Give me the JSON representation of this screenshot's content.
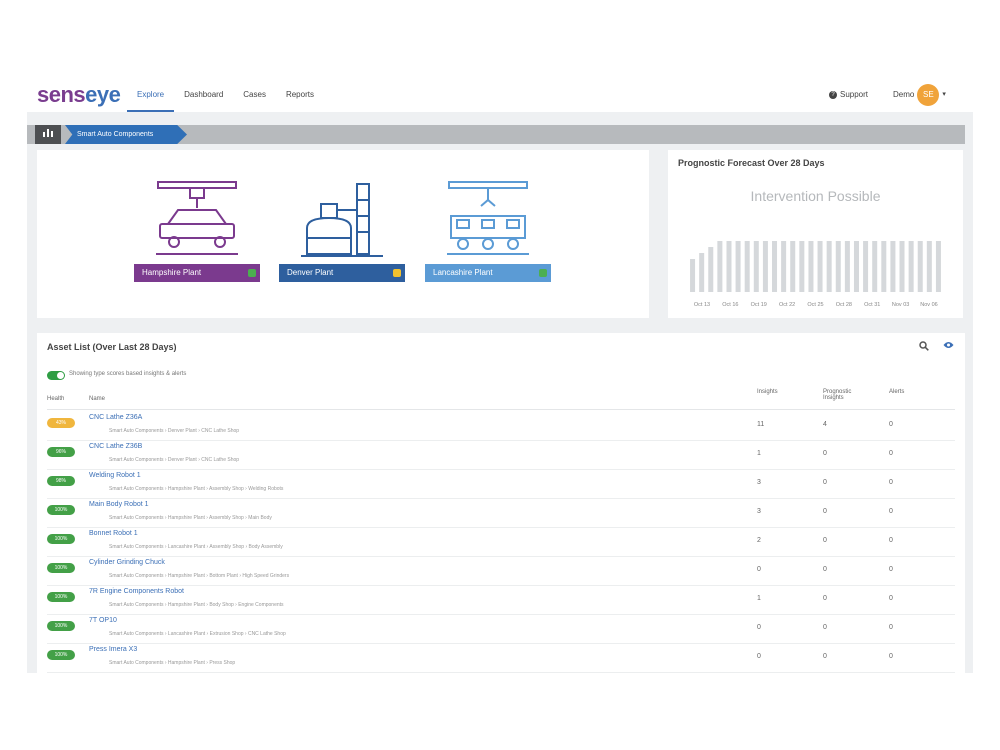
{
  "header": {
    "logo_a": "sens",
    "logo_b": "eye",
    "nav": [
      "Explore",
      "Dashboard",
      "Cases",
      "Reports"
    ],
    "support": "Support",
    "user_name": "Demo",
    "avatar_initials": "SE"
  },
  "breadcrumb": {
    "current": "Smart Auto Components"
  },
  "plants": [
    {
      "label": "Hampshire Plant",
      "color": "#7b3a8e",
      "status_color": "#4caf50"
    },
    {
      "label": "Denver Plant",
      "color": "#2e5f9e",
      "status_color": "#f2c12e"
    },
    {
      "label": "Lancashire Plant",
      "color": "#5b9bd5",
      "status_color": "#4caf50"
    }
  ],
  "forecast": {
    "title": "Prognostic Forecast Over 28 Days",
    "status": "Intervention Possible",
    "dates": [
      "Oct 13",
      "Oct 16",
      "Oct 19",
      "Oct 22",
      "Oct 25",
      "Oct 28",
      "Oct 31",
      "Nov 03",
      "Nov 06"
    ]
  },
  "chart_data": {
    "type": "bar",
    "title": "Prognostic Forecast Over 28 Days",
    "categories": [
      "Oct 13",
      "Oct 16",
      "Oct 19",
      "Oct 22",
      "Oct 25",
      "Oct 28",
      "Oct 31",
      "Nov 03",
      "Nov 06"
    ],
    "values": [
      0.55,
      0.65,
      0.75,
      0.85,
      0.85,
      0.85,
      0.85,
      0.85,
      0.85,
      0.85,
      0.85,
      0.85,
      0.85,
      0.85,
      0.85,
      0.85,
      0.85,
      0.85,
      0.85,
      0.85,
      0.85,
      0.85,
      0.85,
      0.85,
      0.85,
      0.85,
      0.85,
      0.85
    ],
    "ylim": [
      0,
      1
    ]
  },
  "assets": {
    "title": "Asset List (Over Last 28 Days)",
    "toggle_label": "Showing type scores based insights & alerts",
    "columns": {
      "health": "Health",
      "name": "Name",
      "insights": "Insights",
      "prognostic": "Prognostic Insights",
      "alerts": "Alerts"
    },
    "rows": [
      {
        "health": "43%",
        "health_color": "#f0b63d",
        "name": "CNC Lathe Z36A",
        "path": "Smart Auto Components  ›  Denver Plant  ›  CNC Lathe Shop",
        "insights": "11",
        "prognostic": "4",
        "alerts": "0"
      },
      {
        "health": "96%",
        "health_color": "#43a047",
        "name": "CNC Lathe Z36B",
        "path": "Smart Auto Components  ›  Denver Plant  ›  CNC Lathe Shop",
        "insights": "1",
        "prognostic": "0",
        "alerts": "0"
      },
      {
        "health": "98%",
        "health_color": "#43a047",
        "name": "Welding Robot 1",
        "path": "Smart Auto Components  ›  Hampshire Plant  ›  Assembly Shop  ›  Welding Robots",
        "insights": "3",
        "prognostic": "0",
        "alerts": "0"
      },
      {
        "health": "100%",
        "health_color": "#43a047",
        "name": "Main Body Robot 1",
        "path": "Smart Auto Components  ›  Hampshire Plant  ›  Assembly Shop  ›  Main Body",
        "insights": "3",
        "prognostic": "0",
        "alerts": "0"
      },
      {
        "health": "100%",
        "health_color": "#43a047",
        "name": "Bonnet Robot 1",
        "path": "Smart Auto Components  ›  Lancashire Plant  ›  Assembly Shop  ›  Body Assembly",
        "insights": "2",
        "prognostic": "0",
        "alerts": "0"
      },
      {
        "health": "100%",
        "health_color": "#43a047",
        "name": "Cylinder Grinding Chuck",
        "path": "Smart Auto Components  ›  Hampshire Plant  ›  Bottom Plant  ›  High Speed Grinders",
        "insights": "0",
        "prognostic": "0",
        "alerts": "0"
      },
      {
        "health": "100%",
        "health_color": "#43a047",
        "name": "7R Engine Components Robot",
        "path": "Smart Auto Components  ›  Hampshire Plant  ›  Body Shop  ›  Engine Components",
        "insights": "1",
        "prognostic": "0",
        "alerts": "0"
      },
      {
        "health": "100%",
        "health_color": "#43a047",
        "name": "7T OP10",
        "path": "Smart Auto Components  ›  Lancashire Plant  ›  Extrusion Shop  ›  CNC Lathe Shop",
        "insights": "0",
        "prognostic": "0",
        "alerts": "0"
      },
      {
        "health": "100%",
        "health_color": "#43a047",
        "name": "Press Imera X3",
        "path": "Smart Auto Components  ›  Hampshire Plant  ›  Press Shop",
        "insights": "0",
        "prognostic": "0",
        "alerts": "0"
      }
    ]
  }
}
